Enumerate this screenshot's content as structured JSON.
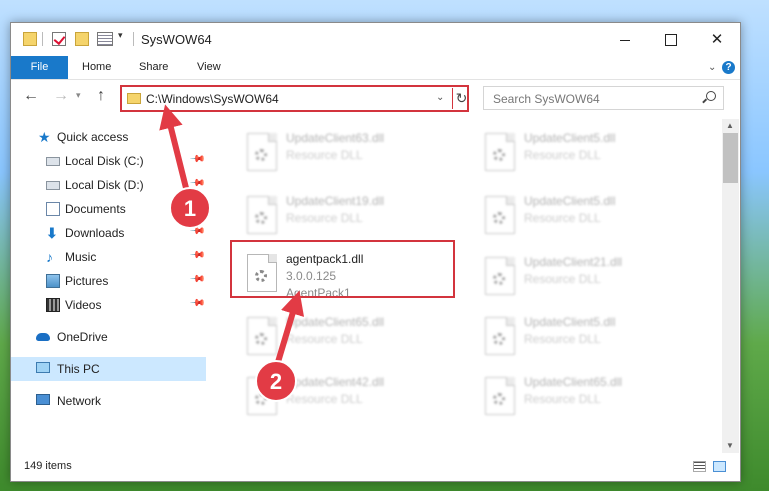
{
  "window": {
    "title": "SysWOW64"
  },
  "ribbon": {
    "tabs": [
      "File",
      "Home",
      "Share",
      "View"
    ],
    "help": "?"
  },
  "nav": {
    "back": "←",
    "forward": "→",
    "up": "↑"
  },
  "address": {
    "path": "C:\\Windows\\SysWOW64",
    "refresh": "↻"
  },
  "search": {
    "placeholder": "Search SysWOW64"
  },
  "sidebar": {
    "items": [
      {
        "label": "Quick access"
      },
      {
        "label": "Local Disk (C:)"
      },
      {
        "label": "Local Disk (D:)"
      },
      {
        "label": "Documents"
      },
      {
        "label": "Downloads"
      },
      {
        "label": "Music"
      },
      {
        "label": "Pictures"
      },
      {
        "label": "Videos"
      },
      {
        "label": "OneDrive"
      },
      {
        "label": "This PC"
      },
      {
        "label": "Network"
      }
    ]
  },
  "files": [
    {
      "name": "UpdateClient63.dll",
      "type": "Resource DLL"
    },
    {
      "name": "UpdateClient5.dll",
      "type": "Resource DLL"
    },
    {
      "name": "UpdateClient19.dll",
      "type": "Resource DLL"
    },
    {
      "name": "UpdateClient5.dll",
      "type": "Resource DLL"
    },
    {
      "name": "agentpack1.dll",
      "version": "3.0.0.125",
      "type": "AgentPack1"
    },
    {
      "name": "UpdateClient21.dll",
      "type": "Resource DLL"
    },
    {
      "name": "UpdateClient65.dll",
      "type": "Resource DLL"
    },
    {
      "name": "UpdateClient5.dll",
      "type": "Resource DLL"
    },
    {
      "name": "UpdateClient42.dll",
      "type": "Resource DLL"
    },
    {
      "name": "UpdateClient65.dll",
      "type": "Resource DLL"
    }
  ],
  "status": {
    "count": "149 items"
  },
  "annotations": {
    "step1": "1",
    "step2": "2",
    "accent": "#e23b45"
  }
}
